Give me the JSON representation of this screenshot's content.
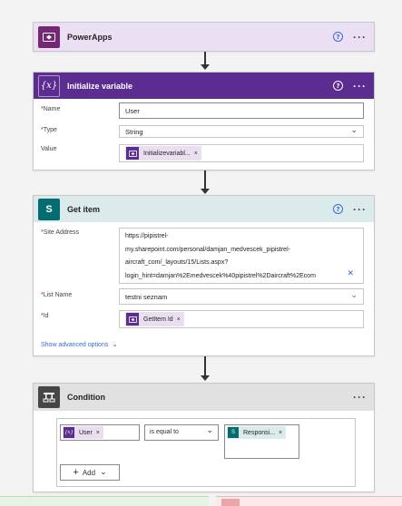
{
  "colors": {
    "powerapps_header": "#ebdff3",
    "powerapps_icon": "#742774",
    "variable_header": "#5c2d91",
    "getitem_header": "#dbebec",
    "getitem_icon": "#036c70",
    "condition_header": "#e1e1e1",
    "condition_icon": "#484644",
    "bottom_left": "#e6f4e6",
    "bottom_right": "#fde9e9"
  },
  "powerapps": {
    "title": "PowerApps",
    "icon": "powerapps-icon",
    "help": "?",
    "more": "···"
  },
  "init_variable": {
    "title": "Initialize variable",
    "icon_text": "{x}",
    "help": "?",
    "more": "···",
    "name_label": "Name",
    "name_value": "User",
    "type_label": "Type",
    "type_value": "String",
    "value_label": "Value",
    "value_token": "Initializevariabl...",
    "token_close": "×",
    "required_mark": "*"
  },
  "get_item": {
    "title": "Get item",
    "icon_text": "S",
    "help": "?",
    "more": "···",
    "site_label": "Site Address",
    "site_lines": [
      "https://pipistrel-",
      "my.sharepoint.com/personal/damjan_medvescek_pipistrel-",
      "aircraft_com/_layouts/15/Lists.aspx?",
      "login_hint=damjan%2Emedvescek%40pipistrel%2Daircraft%2Ecom"
    ],
    "site_clear": "✕",
    "list_label": "List Name",
    "list_value": "testni seznam",
    "id_label": "Id",
    "id_token": "GetItem Id",
    "token_close": "×",
    "advanced": "Show advanced options",
    "required_mark": "*"
  },
  "condition": {
    "title": "Condition",
    "more": "···",
    "left_token": "User",
    "left_icon": "{x}",
    "operator": "is equal to",
    "right_token": "Responsi...",
    "right_icon": "S",
    "token_close": "×",
    "add_label": "Add",
    "add_plus": "+"
  }
}
